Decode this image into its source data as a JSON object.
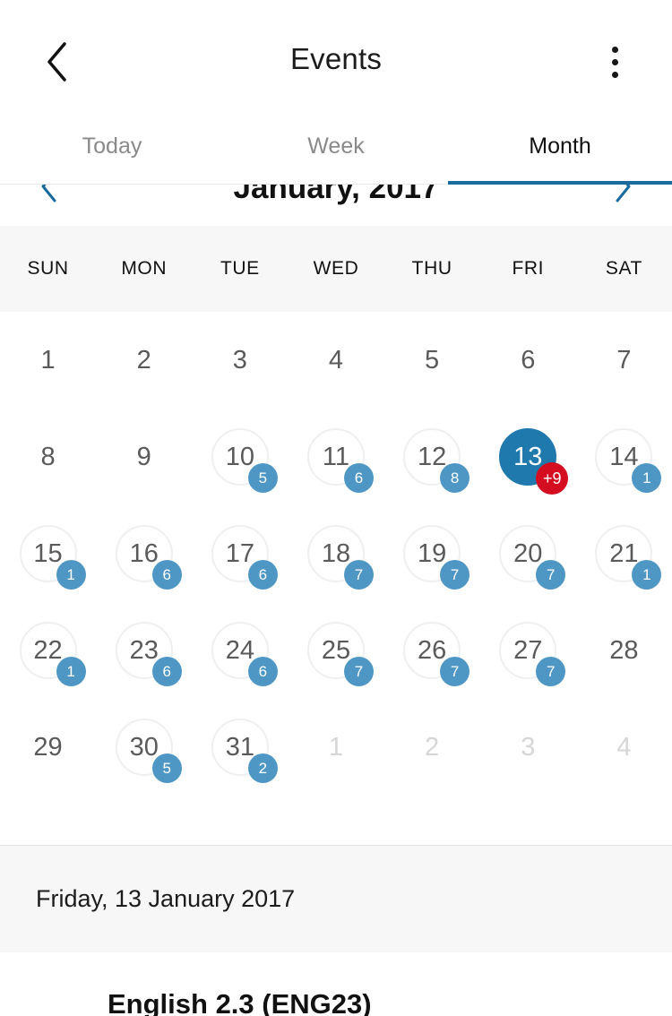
{
  "appbar": {
    "back_icon": "chevron-left-icon",
    "title": "Events",
    "overflow_icon": "more-vertical-icon"
  },
  "tabs": [
    {
      "label": "Today",
      "active": false
    },
    {
      "label": "Week",
      "active": false
    },
    {
      "label": "Month",
      "active": true
    }
  ],
  "month_nav": {
    "prev_icon": "chevron-left-icon",
    "next_icon": "chevron-right-icon",
    "label": "January, 2017"
  },
  "weekdays": [
    "SUN",
    "MON",
    "TUE",
    "WED",
    "THU",
    "FRI",
    "SAT"
  ],
  "weeks": [
    [
      {
        "day": "1",
        "ring": false,
        "badge": null,
        "muted": false,
        "selected": false
      },
      {
        "day": "2",
        "ring": false,
        "badge": null,
        "muted": false,
        "selected": false
      },
      {
        "day": "3",
        "ring": false,
        "badge": null,
        "muted": false,
        "selected": false
      },
      {
        "day": "4",
        "ring": false,
        "badge": null,
        "muted": false,
        "selected": false
      },
      {
        "day": "5",
        "ring": false,
        "badge": null,
        "muted": false,
        "selected": false
      },
      {
        "day": "6",
        "ring": false,
        "badge": null,
        "muted": false,
        "selected": false
      },
      {
        "day": "7",
        "ring": false,
        "badge": null,
        "muted": false,
        "selected": false
      }
    ],
    [
      {
        "day": "8",
        "ring": false,
        "badge": null,
        "muted": false,
        "selected": false
      },
      {
        "day": "9",
        "ring": false,
        "badge": null,
        "muted": false,
        "selected": false
      },
      {
        "day": "10",
        "ring": true,
        "badge": "5",
        "muted": false,
        "selected": false
      },
      {
        "day": "11",
        "ring": true,
        "badge": "6",
        "muted": false,
        "selected": false
      },
      {
        "day": "12",
        "ring": true,
        "badge": "8",
        "muted": false,
        "selected": false
      },
      {
        "day": "13",
        "ring": false,
        "badge": "+9",
        "muted": false,
        "selected": true,
        "badge_alert": true
      },
      {
        "day": "14",
        "ring": true,
        "badge": "1",
        "muted": false,
        "selected": false
      }
    ],
    [
      {
        "day": "15",
        "ring": true,
        "badge": "1",
        "muted": false,
        "selected": false
      },
      {
        "day": "16",
        "ring": true,
        "badge": "6",
        "muted": false,
        "selected": false
      },
      {
        "day": "17",
        "ring": true,
        "badge": "6",
        "muted": false,
        "selected": false
      },
      {
        "day": "18",
        "ring": true,
        "badge": "7",
        "muted": false,
        "selected": false
      },
      {
        "day": "19",
        "ring": true,
        "badge": "7",
        "muted": false,
        "selected": false
      },
      {
        "day": "20",
        "ring": true,
        "badge": "7",
        "muted": false,
        "selected": false
      },
      {
        "day": "21",
        "ring": true,
        "badge": "1",
        "muted": false,
        "selected": false
      }
    ],
    [
      {
        "day": "22",
        "ring": true,
        "badge": "1",
        "muted": false,
        "selected": false
      },
      {
        "day": "23",
        "ring": true,
        "badge": "6",
        "muted": false,
        "selected": false
      },
      {
        "day": "24",
        "ring": true,
        "badge": "6",
        "muted": false,
        "selected": false
      },
      {
        "day": "25",
        "ring": true,
        "badge": "7",
        "muted": false,
        "selected": false
      },
      {
        "day": "26",
        "ring": true,
        "badge": "7",
        "muted": false,
        "selected": false
      },
      {
        "day": "27",
        "ring": true,
        "badge": "7",
        "muted": false,
        "selected": false
      },
      {
        "day": "28",
        "ring": false,
        "badge": null,
        "muted": false,
        "selected": false
      }
    ],
    [
      {
        "day": "29",
        "ring": false,
        "badge": null,
        "muted": false,
        "selected": false
      },
      {
        "day": "30",
        "ring": true,
        "badge": "5",
        "muted": false,
        "selected": false
      },
      {
        "day": "31",
        "ring": true,
        "badge": "2",
        "muted": false,
        "selected": false
      },
      {
        "day": "1",
        "ring": false,
        "badge": null,
        "muted": true,
        "selected": false
      },
      {
        "day": "2",
        "ring": false,
        "badge": null,
        "muted": true,
        "selected": false
      },
      {
        "day": "3",
        "ring": false,
        "badge": null,
        "muted": true,
        "selected": false
      },
      {
        "day": "4",
        "ring": false,
        "badge": null,
        "muted": true,
        "selected": false
      }
    ]
  ],
  "selected_date_header": "Friday, 13 January 2017",
  "events": [
    {
      "title": "English 2.3 (ENG23)"
    }
  ],
  "colors": {
    "accent": "#1a6a9e",
    "selected_day": "#2079ad",
    "badge": "#4e97c4",
    "badge_alert": "#d40e20",
    "ring": "#edeff1",
    "header_band": "#f7f7f7"
  }
}
